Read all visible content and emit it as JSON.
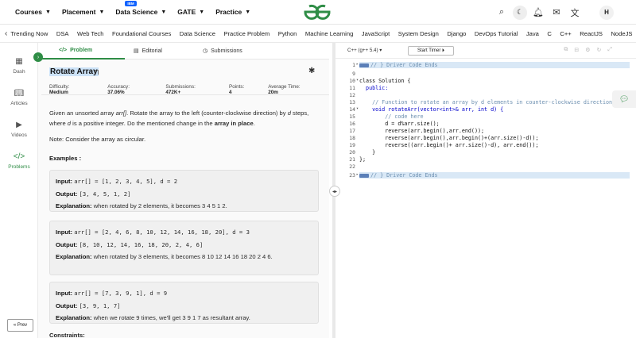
{
  "nav": {
    "menu": [
      {
        "label": "Courses"
      },
      {
        "label": "Placement"
      },
      {
        "label": "Data Science",
        "badge": "IBM"
      },
      {
        "label": "GATE"
      },
      {
        "label": "Practice"
      }
    ],
    "logo_icon": "gfg-logo",
    "icons": [
      "search-icon",
      "moon-icon",
      "bell-icon",
      "message-icon",
      "translate-icon"
    ],
    "avatar": "H"
  },
  "categories": [
    "Trending Now",
    "DSA",
    "Web Tech",
    "Foundational Courses",
    "Data Science",
    "Practice Problem",
    "Python",
    "Machine Learning",
    "JavaScript",
    "System Design",
    "Django",
    "DevOps Tutorial",
    "Java",
    "C",
    "C++",
    "ReactJS",
    "NodeJS"
  ],
  "rail": {
    "items": [
      {
        "label": "Dash",
        "icon": "dashboard-icon"
      },
      {
        "label": "Articles",
        "icon": "book-icon"
      },
      {
        "label": "Videos",
        "icon": "video-icon"
      },
      {
        "label": "Problems",
        "icon": "code-icon",
        "active": true
      }
    ],
    "prev_label": "« Prev"
  },
  "tabs": [
    {
      "label": "Problem",
      "icon": "</>"
    },
    {
      "label": "Editorial",
      "icon": "editorial-icon"
    },
    {
      "label": "Submissions",
      "icon": "clock-icon"
    }
  ],
  "problem": {
    "title": "Rotate Array",
    "meta": {
      "difficulty_label": "Difficulty:",
      "difficulty": "Medium",
      "accuracy_label": "Accuracy:",
      "accuracy": "37.06%",
      "submissions_label": "Submissions:",
      "submissions": "472K+",
      "points_label": "Points:",
      "points": "4",
      "time_label": "Average Time:",
      "time": "20m"
    },
    "desc_1": "Given an unsorted array ",
    "desc_arr": "arr[]",
    "desc_2": ". Rotate the array to the left (counter-clockwise direction) by ",
    "desc_d": "d",
    "desc_3": " steps, where ",
    "desc_d2": "d",
    "desc_4": " is a positive integer. Do the mentioned change in the ",
    "desc_bold": "array in place",
    "desc_5": ".",
    "note": "Note: Consider the array as circular.",
    "examples_heading": "Examples :",
    "examples": [
      {
        "input_label": "Input:",
        "input": "arr[] = [1, 2, 3, 4, 5], d = 2",
        "output_label": "Output:",
        "output": "[3, 4, 5, 1, 2]",
        "explanation_label": "Explanation:",
        "explanation": "when rotated by 2 elements, it becomes 3 4 5 1 2."
      },
      {
        "input_label": "Input:",
        "input": "arr[] = [2, 4, 6, 8, 10, 12, 14, 16, 18, 20], d = 3",
        "output_label": "Output:",
        "output": "[8, 10, 12, 14, 16, 18, 20, 2, 4, 6]",
        "explanation_label": "Explanation:",
        "explanation": "when rotated by 3 elements, it becomes 8 10 12 14 16 18 20 2 4 6."
      },
      {
        "input_label": "Input:",
        "input": "arr[] = [7, 3, 9, 1], d = 9",
        "output_label": "Output:",
        "output": "[3, 9, 1, 7]",
        "explanation_label": "Explanation:",
        "explanation": "when we rotate 9 times, we'll get 3 9 1 7 as resultant array."
      }
    ],
    "constraints_heading": "Constraints:"
  },
  "editor": {
    "language": "C++ (g++ 5.4)",
    "timer_label": "Start Timer",
    "lines": [
      {
        "n": "1",
        "fold": "▸",
        "text": "// } Driver Code Ends",
        "kind": "folded",
        "hl": true
      },
      {
        "n": "9",
        "fold": "",
        "text": "",
        "kind": "plain"
      },
      {
        "n": "10",
        "fold": "▾",
        "text": "class Solution {",
        "kind": "class"
      },
      {
        "n": "11",
        "fold": "",
        "text": "  public:",
        "kind": "kw"
      },
      {
        "n": "12",
        "fold": "",
        "text": "",
        "kind": "plain"
      },
      {
        "n": "13",
        "fold": "",
        "text": "    // Function to rotate an array by d elements in counter-clockwise direction.",
        "kind": "comment"
      },
      {
        "n": "14",
        "fold": "▾",
        "text": "    void rotateArr(vector<int>& arr, int d) {",
        "kind": "sig"
      },
      {
        "n": "15",
        "fold": "",
        "text": "        // code here",
        "kind": "comment"
      },
      {
        "n": "16",
        "fold": "",
        "text": "        d = d%arr.size();",
        "kind": "plain"
      },
      {
        "n": "17",
        "fold": "",
        "text": "        reverse(arr.begin(),arr.end());",
        "kind": "plain"
      },
      {
        "n": "18",
        "fold": "",
        "text": "        reverse(arr.begin(),arr.begin()+(arr.size()-d));",
        "kind": "plain"
      },
      {
        "n": "19",
        "fold": "",
        "text": "        reverse((arr.begin()+ arr.size()-d), arr.end());",
        "kind": "plain"
      },
      {
        "n": "20",
        "fold": "",
        "text": "    }",
        "kind": "plain"
      },
      {
        "n": "21",
        "fold": "",
        "text": "};",
        "kind": "plain"
      },
      {
        "n": "22",
        "fold": "",
        "text": "",
        "kind": "plain"
      },
      {
        "n": "23",
        "fold": "▸",
        "text": "// } Driver Code Ends",
        "kind": "folded",
        "hl": true
      }
    ]
  },
  "colors": {
    "brand": "#2f8d46",
    "ibm_badge": "#0f62fe",
    "highlight": "#d9e8f6"
  }
}
